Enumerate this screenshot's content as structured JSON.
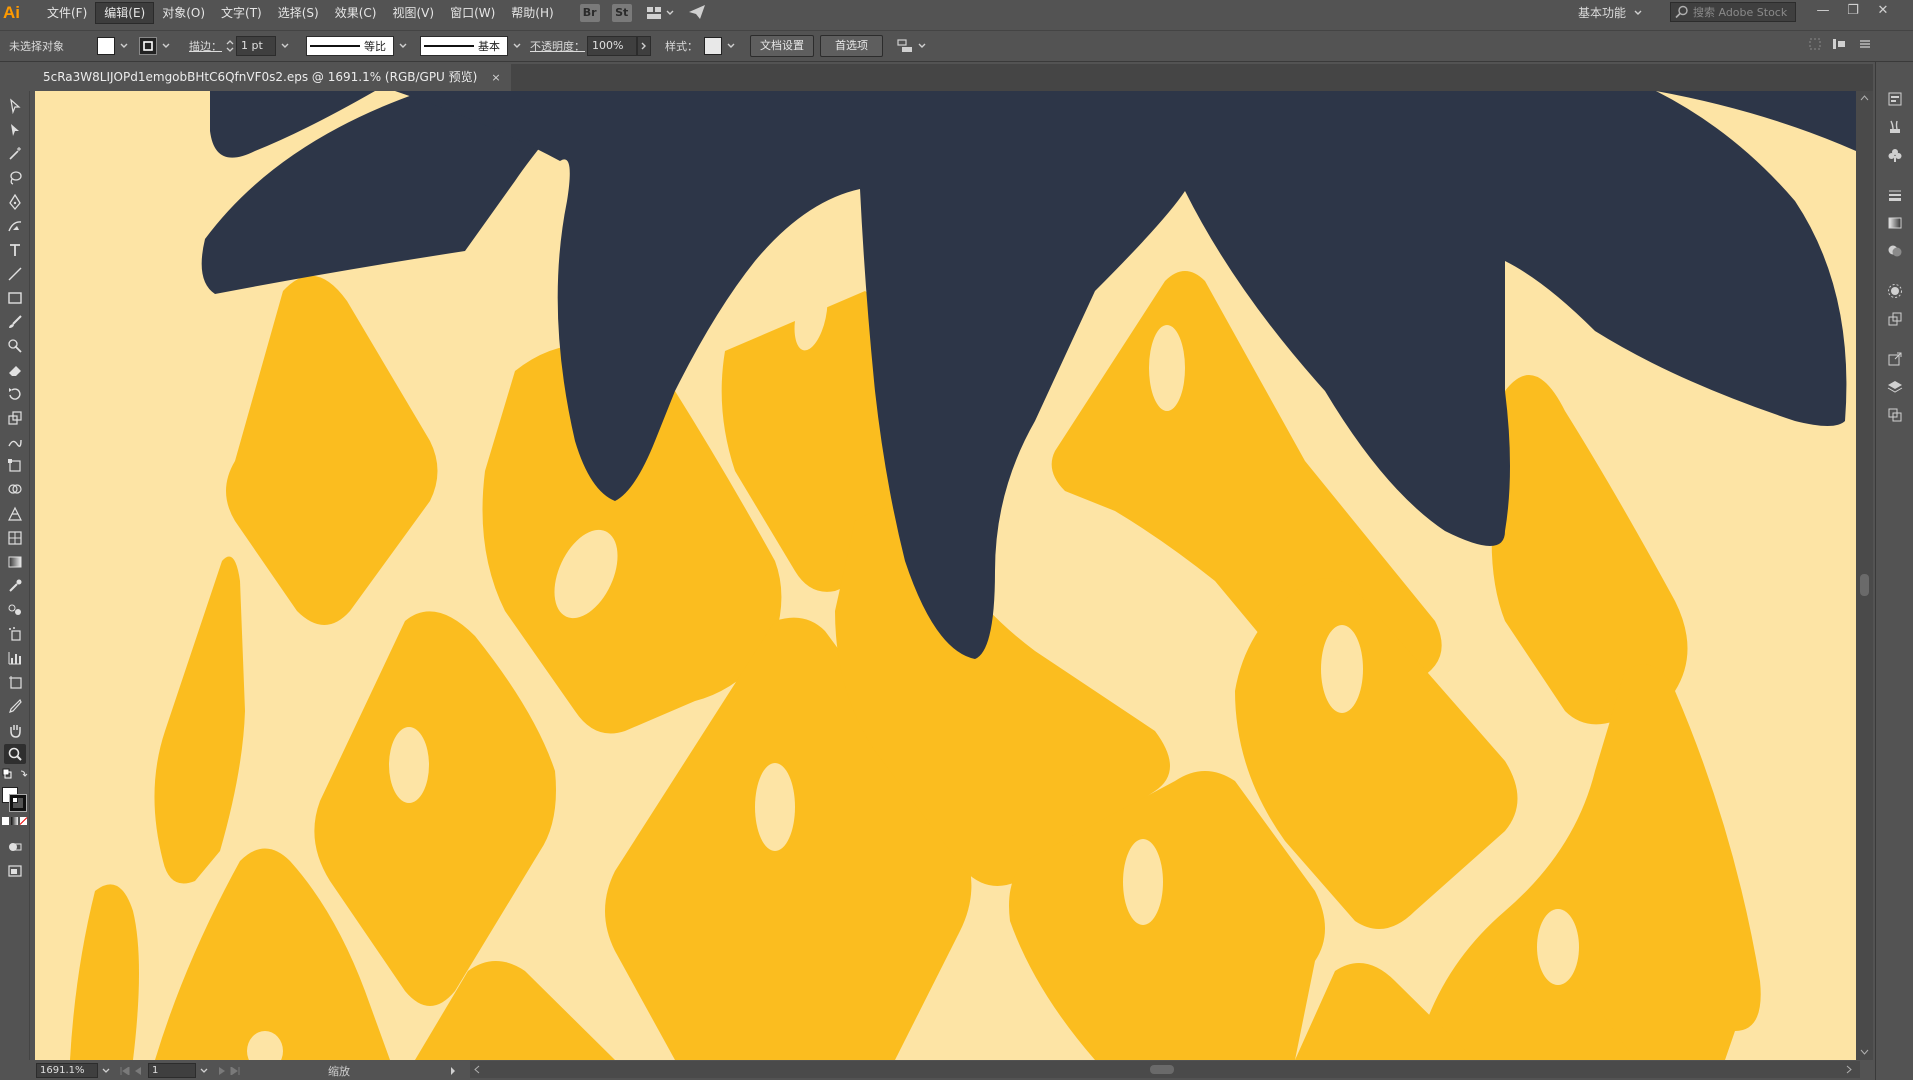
{
  "app": {
    "logo": "Ai"
  },
  "menu": [
    {
      "label": "文件(F)"
    },
    {
      "label": "编辑(E)"
    },
    {
      "label": "对象(O)"
    },
    {
      "label": "文字(T)"
    },
    {
      "label": "选择(S)"
    },
    {
      "label": "效果(C)"
    },
    {
      "label": "视图(V)"
    },
    {
      "label": "窗口(W)"
    },
    {
      "label": "帮助(H)"
    }
  ],
  "menubar_buttons": {
    "bridge": "Br",
    "stock": "St"
  },
  "workspace": {
    "label": "基本功能"
  },
  "search": {
    "placeholder": "搜索 Adobe Stock"
  },
  "control": {
    "selection_status": "未选择对象",
    "stroke_label": "描边：",
    "stroke_weight": "1 pt",
    "stroke_profile": "等比",
    "brush": "基本",
    "opacity_label": "不透明度：",
    "opacity_value": "100%",
    "style_label": "样式：",
    "doc_setup": "文档设置",
    "preferences": "首选项"
  },
  "document": {
    "tab_title": "5cRa3W8LIJOPd1emgobBHtC6QfnVF0s2.eps  @  1691.1%  (RGB/GPU 预览)",
    "close": "×"
  },
  "status": {
    "zoom": "1691.1%",
    "page": "1",
    "tool_name": "缩放"
  },
  "colors": {
    "background": "#fde4a5",
    "fruit": "#fbbd1f",
    "leaves": "#2d3648",
    "ui_dark": "#535353"
  }
}
